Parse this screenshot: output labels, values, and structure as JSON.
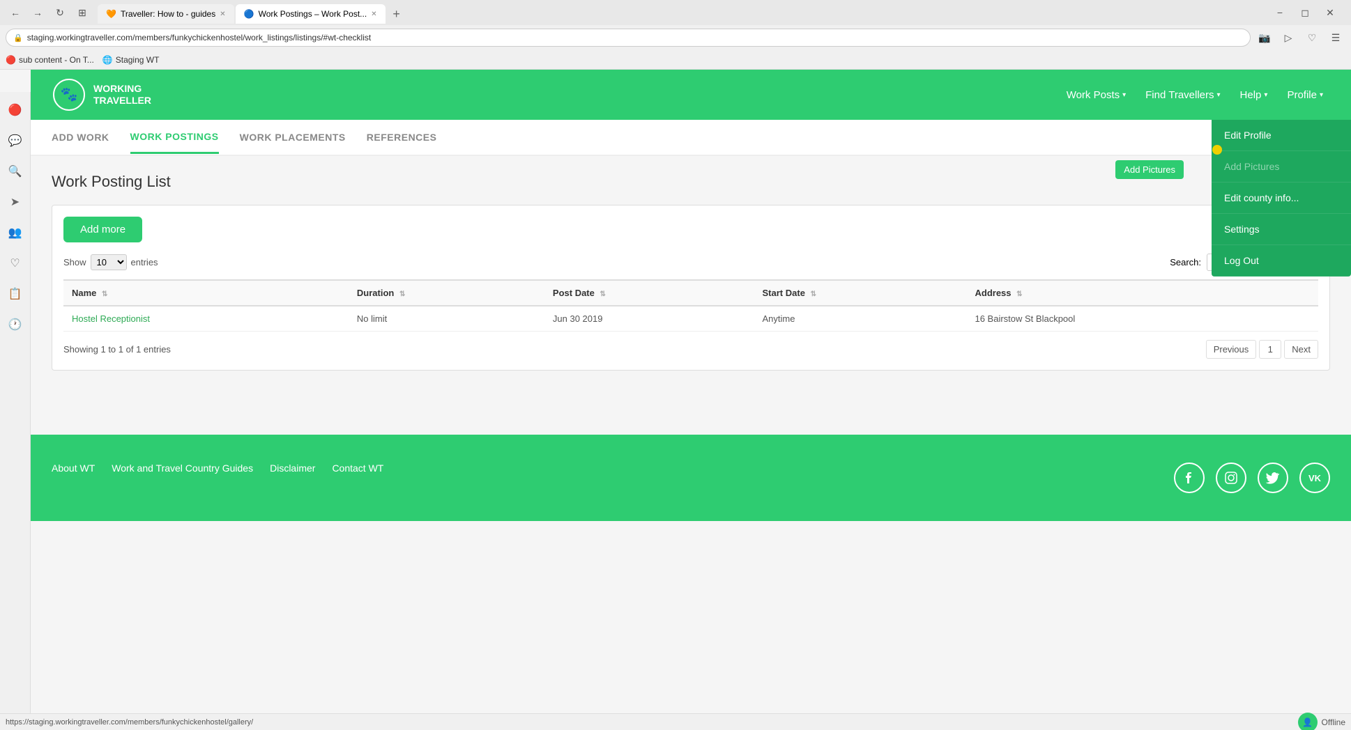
{
  "browser": {
    "tabs": [
      {
        "label": "Traveller: How to - guides",
        "active": false,
        "favicon": "🧡"
      },
      {
        "label": "Work Postings – Work Post...",
        "active": true,
        "favicon": "🔵"
      }
    ],
    "new_tab_label": "+",
    "url": "staging.workingtraveller.com/members/funkychickenhostel/work_listings/listings/#wt-checklist",
    "bookmarks": [
      {
        "label": "sub content - On T..."
      },
      {
        "label": "Staging WT"
      }
    ]
  },
  "header": {
    "logo_lines": [
      "WORKING",
      "TRAVELLER"
    ],
    "nav": [
      {
        "label": "Work Posts",
        "has_chevron": true
      },
      {
        "label": "Find Travellers",
        "has_chevron": true
      },
      {
        "label": "Help",
        "has_chevron": true
      },
      {
        "label": "Profile",
        "has_chevron": true
      }
    ]
  },
  "sub_nav": [
    {
      "label": "ADD WORK",
      "active": false
    },
    {
      "label": "WORK POSTINGS",
      "active": true
    },
    {
      "label": "WORK PLACEMENTS",
      "active": false
    },
    {
      "label": "REFERENCES",
      "active": false
    }
  ],
  "main": {
    "page_title": "Work Posting List",
    "add_button_label": "Add more",
    "show_entries_label": "Show",
    "entries_label": "entries",
    "entries_value": "10",
    "search_label": "Search:",
    "table_headers": [
      "Name",
      "Duration",
      "Post Date",
      "Start Date",
      "Address"
    ],
    "table_rows": [
      {
        "name": "Hostel Receptionist",
        "duration": "No limit",
        "post_date": "Jun 30 2019",
        "start_date": "Anytime",
        "address": "16 Bairstow St Blackpool"
      }
    ],
    "showing_text": "Showing 1 to 1 of 1 entries",
    "prev_label": "Previous",
    "next_label": "Next",
    "page_num": "1"
  },
  "dropdown": {
    "items": [
      {
        "label": "Edit Profile",
        "disabled": false
      },
      {
        "label": "Add Pictures",
        "disabled": true
      },
      {
        "label": "Edit county info...",
        "disabled": false
      },
      {
        "label": "Settings",
        "disabled": false
      },
      {
        "label": "Log Out",
        "disabled": false
      }
    ]
  },
  "tooltip": {
    "label": "Add Pictures"
  },
  "footer": {
    "links": [
      {
        "label": "About WT"
      },
      {
        "label": "Work and Travel Country Guides"
      },
      {
        "label": "Disclaimer"
      },
      {
        "label": "Contact WT"
      }
    ],
    "socials": [
      {
        "icon": "f",
        "name": "facebook"
      },
      {
        "icon": "📷",
        "name": "instagram"
      },
      {
        "icon": "🐦",
        "name": "twitter"
      },
      {
        "icon": "VK",
        "name": "vk"
      }
    ]
  },
  "sidebar_icons": [
    {
      "icon": "🔴",
      "name": "opera-icon"
    },
    {
      "icon": "📱",
      "name": "messenger-icon"
    },
    {
      "icon": "🔍",
      "name": "search-icon"
    },
    {
      "icon": "➤",
      "name": "send-icon"
    },
    {
      "icon": "👤",
      "name": "contacts-icon"
    },
    {
      "icon": "♡",
      "name": "favorites-icon"
    },
    {
      "icon": "📋",
      "name": "notes-icon"
    },
    {
      "icon": "🕐",
      "name": "history-icon"
    }
  ],
  "status_bar": {
    "url": "https://staging.workingtraveller.com/members/funkychickenhostel/gallery/",
    "offline_label": "Offline"
  }
}
